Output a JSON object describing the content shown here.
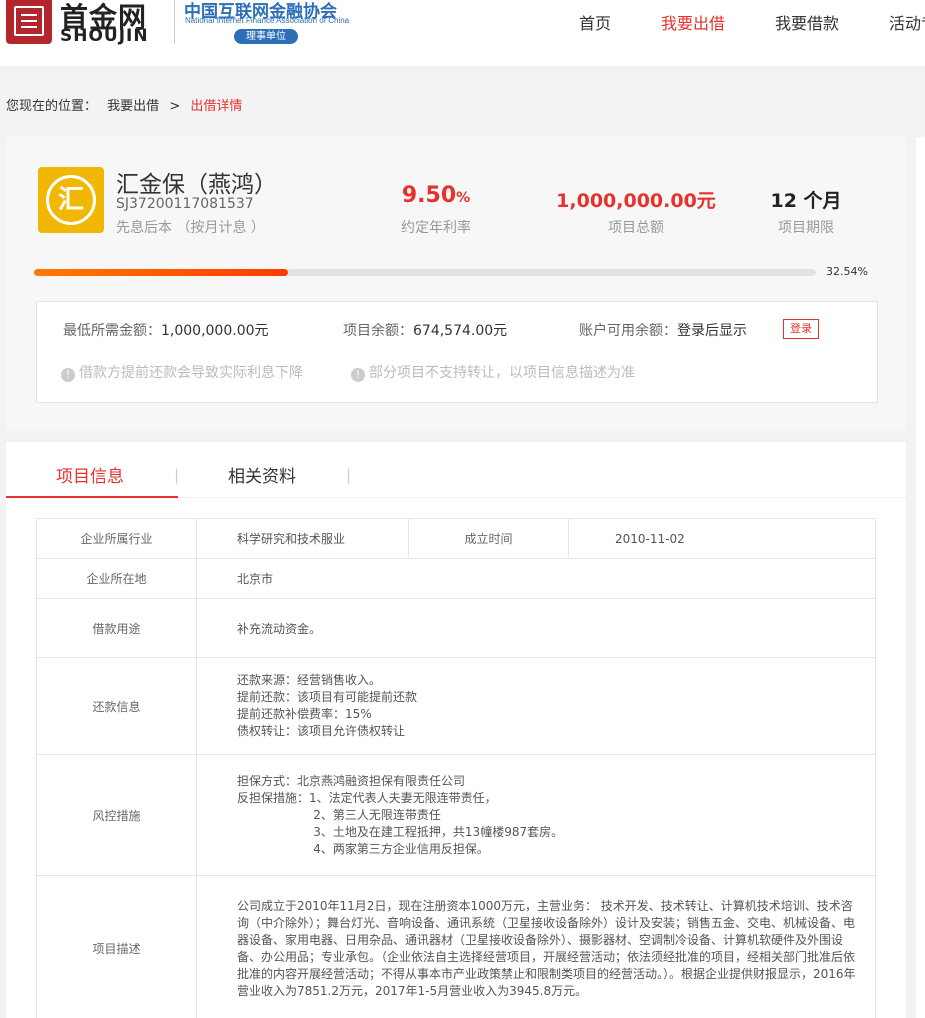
{
  "header": {
    "logo_cn": "首金网",
    "logo_en": "SHOUJIN",
    "assoc_cn": "中国互联网金融协会",
    "assoc_en": "National Internet Finance Association of China",
    "assoc_badge": "理事单位",
    "nav": [
      "首页",
      "我要出借",
      "我要借款",
      "活动专"
    ],
    "nav_active_index": 1
  },
  "breadcrumb": {
    "prefix": "您现在的位置：",
    "parent": "我要出借",
    "sep": ">",
    "current": "出借详情"
  },
  "product": {
    "icon_char": "汇",
    "name": "汇金保（燕鸿）",
    "code": "SJ37200117081537",
    "repay_type": "先息后本 （按月计息 ）",
    "rate_value": "9.50",
    "rate_unit": "%",
    "rate_label": "约定年利率",
    "total_value": "1,000,000.00元",
    "total_label": "项目总额",
    "term_value": "12 个月",
    "term_label": "项目期限",
    "progress_percent": 32.54,
    "progress_text": "32.54%"
  },
  "info_box": {
    "min_amount_label": "最低所需金额：",
    "min_amount_value": "1,000,000.00元",
    "remain_label": "项目余额：",
    "remain_value": "674,574.00元",
    "balance_label": "账户可用余额：",
    "balance_value": "登录后显示",
    "login_label": "登录",
    "tip1": "借款方提前还款会导致实际利息下降",
    "tip2": "部分项目不支持转让，以项目信息描述为准",
    "tip_icon": "!"
  },
  "tabs": [
    {
      "label": "项目信息",
      "active": true
    },
    {
      "label": "相关资料",
      "active": false
    }
  ],
  "tab_sep": "|",
  "details": {
    "industry_label": "企业所属行业",
    "industry_value": "科学研究和技术服业",
    "founded_label": "成立时间",
    "founded_value": "2010-11-02",
    "location_label": "企业所在地",
    "location_value": "北京市",
    "purpose_label": "借款用途",
    "purpose_value": "补充流动资金。",
    "repay_label": "还款信息",
    "repay_lines": [
      "还款来源：经营销售收入。",
      "提前还款：该项目有可能提前还款",
      "提前还款补偿费率：15%",
      "债权转让：该项目允许债权转让"
    ],
    "risk_label": "风控措施",
    "risk_lines": [
      "担保方式：北京燕鸿融资担保有限责任公司",
      "反担保措施：1、法定代表人夫妻无限连带责任，",
      "                    2、第三人无限连带责任",
      "                    3、土地及在建工程抵押，共13幢楼987套房。",
      "                    4、两家第三方企业信用反担保。"
    ],
    "desc_label": "项目描述",
    "desc_value": "公司成立于2010年11月2日，现在注册资本1000万元，主营业务： 技术开发、技术转让、计算机技术培训、技术咨询（中介除外）；舞台灯光、音响设备、通讯系统（卫星接收设备除外）设计及安装；销售五金、交电、机械设备、电器设备、家用电器、日用杂品、通讯器材（卫星接收设备除外）、摄影器材、空调制冷设备、计算机软硬件及外围设备、办公用品；专业承包。（企业依法自主选择经营项目，开展经营活动；依法须经批准的项目，经相关部门批准后依批准的内容开展经营活动；不得从事本市产业政策禁止和限制类项目的经营活动。）。根据企业提供财报显示，2016年营业收入为7851.2万元，2017年1-5月营业收入为3945.8万元。"
  }
}
